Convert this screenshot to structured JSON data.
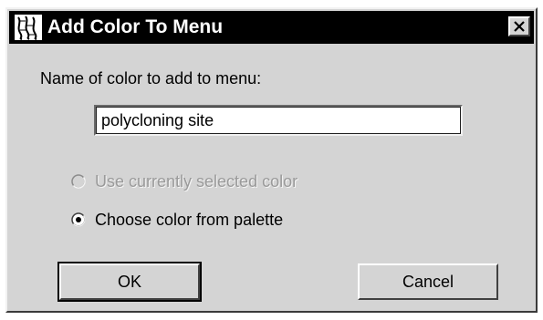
{
  "window": {
    "title": "Add Color To Menu",
    "app_icon": "chromosome-icon",
    "close_icon": "close-x-icon"
  },
  "form": {
    "name_label": "Name of color to add to menu:",
    "name_value": "polycloning site"
  },
  "options": [
    {
      "label": "Use currently selected color",
      "selected": false,
      "enabled": false
    },
    {
      "label": "Choose color from palette",
      "selected": true,
      "enabled": true
    }
  ],
  "buttons": {
    "ok_label": "OK",
    "cancel_label": "Cancel"
  },
  "colors": {
    "titlebar": "#000000",
    "face": "#d4d4d4",
    "disabled_text": "#9a9a9a"
  }
}
